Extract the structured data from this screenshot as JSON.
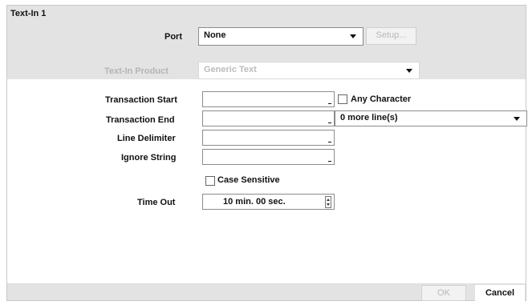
{
  "dialog": {
    "title": "Text-In 1"
  },
  "port": {
    "label": "Port",
    "value": "None",
    "setup_label": "Setup..."
  },
  "product": {
    "label": "Text-In Product",
    "value": "Generic Text"
  },
  "transaction_start": {
    "label": "Transaction Start",
    "value": "",
    "any_character_label": "Any Character"
  },
  "transaction_end": {
    "label": "Transaction End",
    "value": "",
    "lines_value": "0 more line(s)"
  },
  "line_delimiter": {
    "label": "Line Delimiter",
    "value": ""
  },
  "ignore_string": {
    "label": "Ignore String",
    "value": ""
  },
  "case_sensitive": {
    "label": "Case Sensitive",
    "checked": false
  },
  "time_out": {
    "label": "Time Out",
    "value": "10 min. 00 sec."
  },
  "footer": {
    "ok_label": "OK",
    "cancel_label": "Cancel"
  }
}
